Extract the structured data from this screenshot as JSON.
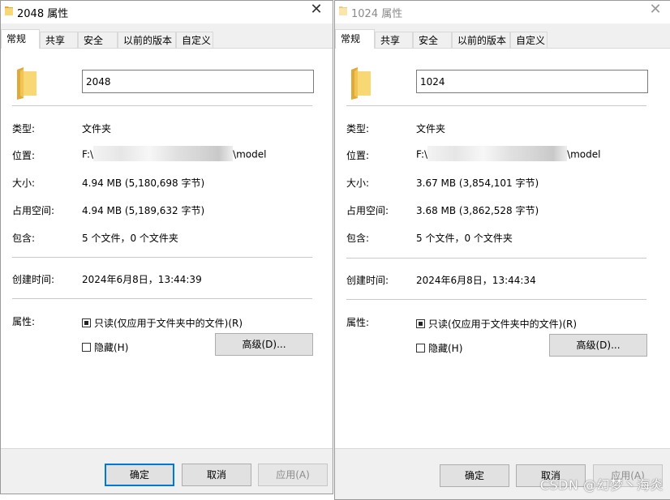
{
  "left": {
    "title": "2048 属性",
    "tabs": [
      "常规",
      "共享",
      "安全",
      "以前的版本",
      "自定义"
    ],
    "name_value": "2048",
    "labels": {
      "type": "类型:",
      "location": "位置:",
      "size": "大小:",
      "disk_size": "占用空间:",
      "contains": "包含:",
      "created": "创建时间:",
      "attributes": "属性:"
    },
    "values": {
      "type": "文件夹",
      "location_prefix": "F:\\",
      "location_suffix": "\\model",
      "size": "4.94 MB (5,180,698 字节)",
      "disk_size": "4.94 MB (5,189,632 字节)",
      "contains": "5 个文件，0 个文件夹",
      "created": "2024年6月8日，13:44:39"
    },
    "readonly_label": "只读(仅应用于文件夹中的文件)(R)",
    "hidden_label": "隐藏(H)",
    "advanced_label": "高级(D)...",
    "ok_label": "确定",
    "cancel_label": "取消",
    "apply_label": "应用(A)"
  },
  "right": {
    "title": "1024 属性",
    "tabs": [
      "常规",
      "共享",
      "安全",
      "以前的版本",
      "自定义"
    ],
    "name_value": "1024",
    "labels": {
      "type": "类型:",
      "location": "位置:",
      "size": "大小:",
      "disk_size": "占用空间:",
      "contains": "包含:",
      "created": "创建时间:",
      "attributes": "属性:"
    },
    "values": {
      "type": "文件夹",
      "location_prefix": "F:\\",
      "location_suffix": "\\model",
      "size": "3.67 MB (3,854,101 字节)",
      "disk_size": "3.68 MB (3,862,528 字节)",
      "contains": "5 个文件，0 个文件夹",
      "created": "2024年6月8日，13:44:34"
    },
    "readonly_label": "只读(仅应用于文件夹中的文件)(R)",
    "hidden_label": "隐藏(H)",
    "advanced_label": "高级(D)...",
    "ok_label": "确定",
    "cancel_label": "取消",
    "apply_label": "应用(A)"
  },
  "watermark": "CSDN @幻梦丶海炎",
  "colors": {
    "dialog_bg": "#f0f0f0",
    "panel_bg": "#ffffff",
    "focus_border": "#0078d7",
    "folder_yellow": "#f8d775",
    "folder_dark": "#e0a93b"
  },
  "icons": {
    "title": "folder-icon",
    "large": "folder-icon",
    "close": "close-icon"
  }
}
